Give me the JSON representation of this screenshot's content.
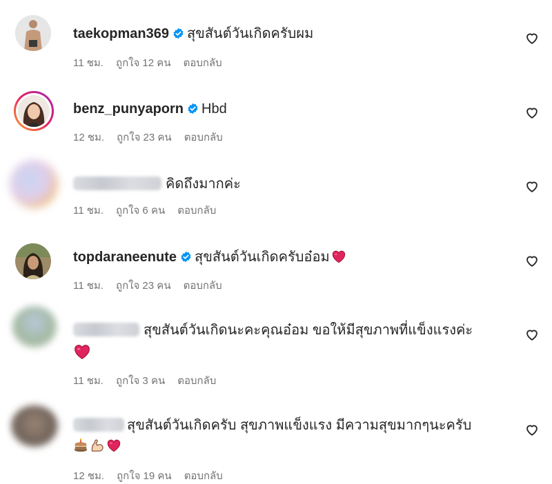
{
  "comments": [
    {
      "username": "taekopman369",
      "verified": true,
      "text": "สุขสันต์วันเกิดครับผม",
      "time": "11 ชม.",
      "likes": "ถูกใจ 12 คน",
      "reply": "ตอบกลับ"
    },
    {
      "username": "benz_punyaporn",
      "verified": true,
      "text": "Hbd",
      "time": "12 ชม.",
      "likes": "ถูกใจ 23 คน",
      "reply": "ตอบกลับ"
    },
    {
      "username": "",
      "verified": false,
      "text": "คิดถึงมากค่ะ",
      "time": "11 ชม.",
      "likes": "ถูกใจ 6 คน",
      "reply": "ตอบกลับ"
    },
    {
      "username": "topdaraneenute",
      "verified": true,
      "text": "สุขสันต์วันเกิดครับอ๋อม",
      "time": "11 ชม.",
      "likes": "ถูกใจ 23 คน",
      "reply": "ตอบกลับ"
    },
    {
      "username": "",
      "verified": false,
      "text": "สุขสันต์วันเกิดนะคะคุณอ๋อม ขอให้มีสุขภาพที่แข็งแรงค่ะ",
      "time": "11 ชม.",
      "likes": "ถูกใจ 3 คน",
      "reply": "ตอบกลับ"
    },
    {
      "username": "",
      "verified": false,
      "text": "สุขสันต์วันเกิดครับ สุขภาพแข็งแรง มีความสุขมากๆนะครับ",
      "time": "12 ชม.",
      "likes": "ถูกใจ 19 คน",
      "reply": "ตอบกลับ"
    }
  ],
  "icons": {
    "verified": "verified-badge-icon",
    "like": "heart-outline-icon",
    "red_heart": "red-heart-emoji",
    "cake": "cake-emoji",
    "muscle": "flexed-biceps-emoji"
  },
  "colors": {
    "verified": "#0095f6",
    "meta": "#737373",
    "heart": "#e0245e"
  }
}
